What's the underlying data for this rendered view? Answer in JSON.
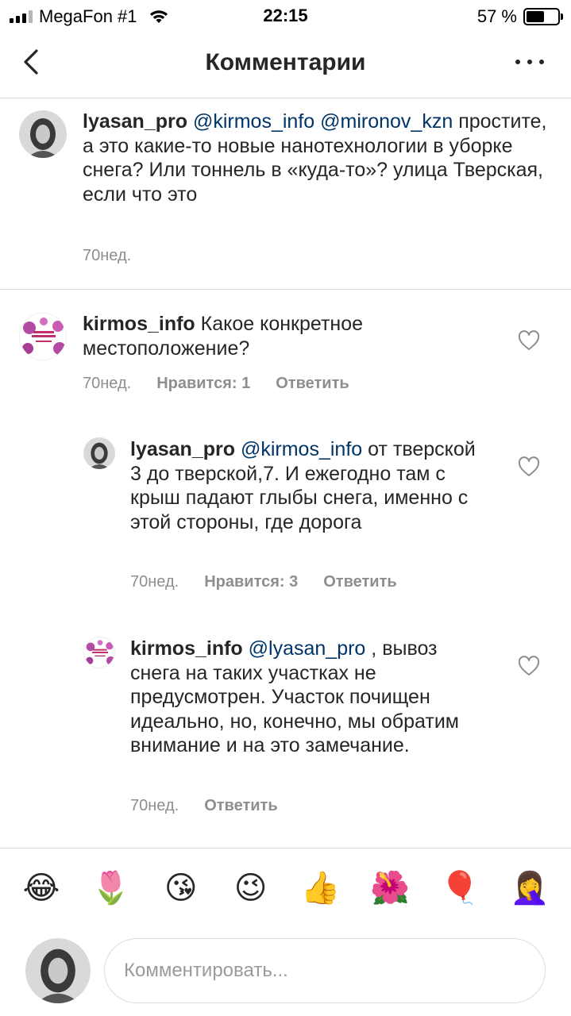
{
  "status_bar": {
    "carrier": "MegaFon #1",
    "time": "22:15",
    "battery_text": "57 %",
    "battery_level": 0.57
  },
  "nav": {
    "title": "Комментарии",
    "back_icon": "chevron-left-icon",
    "more_icon": "more-horizontal-icon"
  },
  "caption": {
    "username": "lyasan_pro",
    "mention_1": "@kirmos_info",
    "mention_2": "@mironov_kzn",
    "text": "простите, а это какие-то новые нанотехнологии в уборке снега? Или тоннель в «куда-то»? улица Тверская, если что это",
    "time": "70нед."
  },
  "comments": [
    {
      "username": "kirmos_info",
      "text": "Какое конкретное местоположение?",
      "time": "70нед.",
      "likes": "Нравится: 1",
      "reply": "Ответить"
    },
    {
      "username": "lyasan_pro",
      "mention": "@kirmos_info",
      "text": "от тверской 3 до тверской,7. И ежегодно там с крыш падают глыбы снега, именно с этой стороны, где дорога",
      "time": "70нед.",
      "likes": "Нравится: 3",
      "reply": "Ответить"
    },
    {
      "username": "kirmos_info",
      "mention": "@lyasan_pro",
      "text": ", вывоз снега на таких участках не предусмотрен. Участок  почищен идеально, но, конечно, мы обратим внимание и на это замечание.",
      "time": "70нед.",
      "reply": "Ответить"
    }
  ],
  "emoji_bar": [
    "😂",
    "🌷",
    "😘",
    "😉",
    "👍",
    "🌺",
    "🎈",
    "🤦‍♀️"
  ],
  "composer": {
    "placeholder": "Комментировать..."
  }
}
